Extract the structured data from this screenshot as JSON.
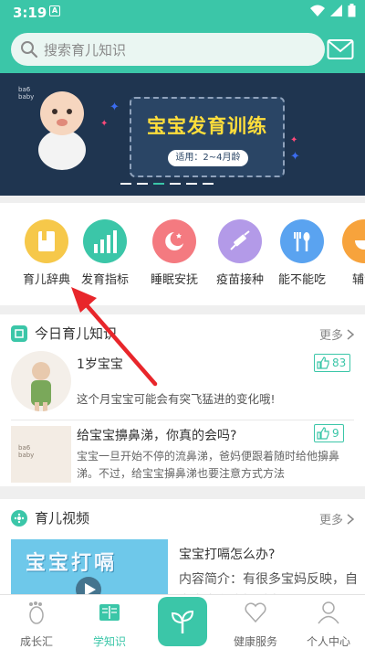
{
  "status": {
    "time": "3:19",
    "notif": "A"
  },
  "search": {
    "placeholder": "搜索育儿知识"
  },
  "banner": {
    "title": "宝宝发育训练",
    "subtitle": "适用：2~4月龄",
    "active_dot": 2,
    "dot_count": 6,
    "logo_text": "ba6\nbaby"
  },
  "quick_links": [
    {
      "label": "育儿辞典",
      "icon": "book-icon",
      "color": "#f6c84a"
    },
    {
      "label": "发育指标",
      "icon": "bar-chart-icon",
      "color": "#3bc6a8"
    },
    {
      "label": "睡眠安抚",
      "icon": "moon-star-icon",
      "color": "#f47a80"
    },
    {
      "label": "疫苗接种",
      "icon": "syringe-icon",
      "color": "#b39ae8"
    },
    {
      "label": "能不能吃",
      "icon": "fork-spoon-icon",
      "color": "#5aa3f0"
    },
    {
      "label": "辅食",
      "icon": "bowl-icon",
      "color": "#f7a33c"
    }
  ],
  "knowledge": {
    "title": "今日育儿知识",
    "more": "更多",
    "items": [
      {
        "title": "1岁宝宝",
        "desc": "这个月宝宝可能会有突飞猛进的变化哦!",
        "likes": "83"
      },
      {
        "title": "给宝宝擤鼻涕，你真的会吗?",
        "desc": "宝宝一旦开始不停的流鼻涕，爸妈便跟着随时给他擤鼻涕。不过，给宝宝擤鼻涕也要注意方式方法",
        "likes": "9"
      }
    ]
  },
  "video": {
    "title": "育儿视频",
    "more": "更多",
    "item": {
      "thumb_text": "宝宝打嗝",
      "title": "宝宝打嗝怎么办?",
      "desc": "内容简介：有很多宝妈反映，自家宝宝在吃奶时容易"
    }
  },
  "nav": [
    {
      "label": "成长汇",
      "icon": "footprint-icon"
    },
    {
      "label": "学知识",
      "icon": "book-open-icon",
      "active": true
    },
    {
      "label": "",
      "icon": "sprout-icon"
    },
    {
      "label": "健康服务",
      "icon": "heart-icon"
    },
    {
      "label": "个人中心",
      "icon": "person-icon"
    }
  ],
  "colors": {
    "accent": "#3bc6a8",
    "banner_bg": "#1f3550",
    "annotation_arrow": "#e8262b"
  }
}
